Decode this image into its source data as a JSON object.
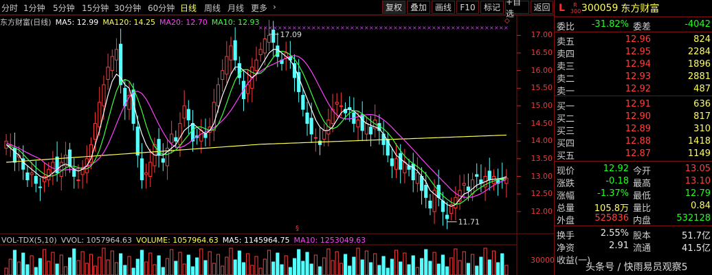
{
  "toolbar": {
    "periods": [
      "分时",
      "1分钟",
      "5分钟",
      "15分钟",
      "30分钟",
      "60分钟",
      "日线",
      "周线",
      "月线",
      "更多"
    ],
    "active": "日线",
    "more_icon": "chevron-right-icon",
    "buttons": [
      "复权",
      "叠加",
      "画线",
      "F10",
      "标记",
      "+自选",
      "返回"
    ]
  },
  "chart_title": "东方财富(日线)",
  "ma_legend": [
    {
      "label": "MA5: 12.99",
      "color": "#ffffff"
    },
    {
      "label": "MA120: 14.25",
      "color": "#ffff54"
    },
    {
      "label": "MA20: 12.70",
      "color": "#ff40ff"
    },
    {
      "label": "MA10: 12.93",
      "color": "#40ff40"
    }
  ],
  "vol_legend": [
    {
      "label": "VOL-TDX(5,10)",
      "color": "#c8c8c8"
    },
    {
      "label": "VVOL: 1057964.63",
      "color": "#c8c8c8"
    },
    {
      "label": "VOLUME: 1057964.63",
      "color": "#ffff54"
    },
    {
      "label": "MA5: 1145964.75",
      "color": "#ffffff"
    },
    {
      "label": "MA10: 1253049.63",
      "color": "#ff40ff"
    }
  ],
  "chart_data": {
    "type": "candlestick",
    "yaxis_ticks": [
      17.0,
      16.5,
      16.0,
      15.5,
      15.0,
      14.5,
      14.0,
      13.5,
      13.0,
      12.5,
      12.0
    ],
    "volume_tick": 30000,
    "annotations": [
      "17.09",
      "11.71"
    ],
    "high_label": "17.09",
    "low_label": "11.71",
    "closes": [
      14.0,
      13.9,
      13.4,
      13.6,
      13.2,
      12.9,
      13.1,
      12.8,
      12.7,
      13.0,
      13.2,
      13.4,
      13.1,
      13.4,
      13.6,
      13.3,
      13.0,
      12.9,
      13.2,
      13.5,
      13.9,
      14.5,
      15.1,
      15.6,
      16.1,
      16.4,
      16.6,
      15.6,
      15.0,
      15.3,
      14.5,
      13.6,
      12.9,
      13.1,
      13.4,
      13.9,
      13.6,
      13.4,
      13.8,
      14.2,
      14.0,
      14.5,
      15.0,
      14.6,
      14.0,
      14.1,
      14.3,
      14.1,
      14.4,
      15.1,
      15.6,
      16.0,
      16.4,
      16.7,
      16.3,
      15.8,
      15.2,
      15.6,
      16.1,
      16.3,
      16.6,
      16.9,
      17.0,
      16.8,
      16.4,
      16.2,
      16.5,
      16.3,
      15.8,
      15.4,
      14.9,
      14.5,
      14.2,
      14.1,
      13.9,
      14.3,
      14.6,
      14.9,
      15.1,
      15.0,
      14.8,
      14.9,
      14.5,
      14.6,
      14.3,
      14.5,
      14.2,
      14.6,
      14.3,
      13.9,
      13.6,
      13.3,
      13.5,
      13.2,
      13.4,
      13.2,
      12.9,
      13.1,
      12.6,
      12.4,
      12.1,
      12.6,
      12.4,
      12.0,
      11.8,
      12.2,
      12.4,
      12.6,
      12.8,
      12.6,
      12.9,
      13.0,
      12.8,
      13.0,
      12.9,
      13.0,
      12.8,
      12.9,
      12.95
    ],
    "ma5": [
      13.9,
      13.8,
      13.7,
      13.6,
      13.4,
      13.3,
      13.2,
      13.1,
      13.0,
      12.95,
      13.0,
      13.1,
      13.2,
      13.3,
      13.35,
      13.3,
      13.2,
      13.15,
      13.2,
      13.3,
      13.5,
      13.9,
      14.3,
      14.8,
      15.3,
      15.7,
      15.9,
      15.8,
      15.6,
      15.5,
      15.1,
      14.6,
      14.2,
      13.9,
      13.7,
      13.6,
      13.6,
      13.6,
      13.7,
      13.8,
      13.9,
      14.1,
      14.3,
      14.4,
      14.5,
      14.4,
      14.3,
      14.2,
      14.3,
      14.5,
      14.9,
      15.3,
      15.6,
      15.9,
      16.1,
      16.1,
      16.0,
      15.9,
      15.8,
      15.9,
      16.1,
      16.3,
      16.5,
      16.6,
      16.6,
      16.5,
      16.4,
      16.3,
      16.1,
      15.8,
      15.5,
      15.2,
      14.9,
      14.6,
      14.4,
      14.3,
      14.3,
      14.4,
      14.6,
      14.8,
      14.9,
      14.9,
      14.85,
      14.75,
      14.6,
      14.5,
      14.45,
      14.4,
      14.35,
      14.2,
      14.0,
      13.8,
      13.6,
      13.5,
      13.4,
      13.3,
      13.25,
      13.15,
      13.0,
      12.85,
      12.6,
      12.5,
      12.4,
      12.3,
      12.2,
      12.15,
      12.2,
      12.35,
      12.5,
      12.55,
      12.65,
      12.75,
      12.8,
      12.85,
      12.9,
      12.92,
      12.93,
      12.95,
      12.99
    ]
  },
  "quote": {
    "badge_l": "L",
    "badge_r_top": "R",
    "badge_r_bottom": "300",
    "code": "300059",
    "name": "东方财富",
    "wei_bi_label": "委比",
    "wei_bi": "-31.82%",
    "wei_cha_label": "委差",
    "wei_cha": "-4042",
    "sell": [
      {
        "label": "卖五",
        "price": "12.96",
        "vol": "824"
      },
      {
        "label": "卖四",
        "price": "12.95",
        "vol": "2284"
      },
      {
        "label": "卖三",
        "price": "12.94",
        "vol": "1896"
      },
      {
        "label": "卖二",
        "price": "12.93",
        "vol": "2881"
      },
      {
        "label": "卖一",
        "price": "12.92",
        "vol": "487"
      }
    ],
    "buy": [
      {
        "label": "买一",
        "price": "12.91",
        "vol": "636"
      },
      {
        "label": "买二",
        "price": "12.90",
        "vol": "817"
      },
      {
        "label": "买三",
        "price": "12.89",
        "vol": "310"
      },
      {
        "label": "买四",
        "price": "12.88",
        "vol": "1418"
      },
      {
        "label": "买五",
        "price": "12.87",
        "vol": "1149"
      }
    ],
    "stats": [
      {
        "l1": "现价",
        "v1": "12.92",
        "c1": "green",
        "l2": "今开",
        "v2": "13.05",
        "c2": "red"
      },
      {
        "l1": "涨跌",
        "v1": "-0.18",
        "c1": "green",
        "l2": "最高",
        "v2": "13.10",
        "c2": "red"
      },
      {
        "l1": "涨幅",
        "v1": "-1.37%",
        "c1": "green",
        "l2": "最低",
        "v2": "12.79",
        "c2": "green"
      },
      {
        "l1": "总量",
        "v1": "105.8万",
        "c1": "yellow",
        "l2": "量比",
        "v2": "0.84",
        "c2": "yellow"
      },
      {
        "l1": "外盘",
        "v1": "525836",
        "c1": "red",
        "l2": "内盘",
        "v2": "532128",
        "c2": "green"
      }
    ],
    "extra": [
      {
        "l1": "换手",
        "v1": "2.55%",
        "l2": "股本",
        "v2": "51.7亿"
      },
      {
        "l1": "净资",
        "v1": "2.91",
        "l2": "流通",
        "v2": "41.5亿"
      },
      {
        "l1": "收益(一)",
        "v1": "",
        "l2": "",
        "v2": ""
      }
    ]
  },
  "watermark": "头条号 / 快雨易员观察5"
}
